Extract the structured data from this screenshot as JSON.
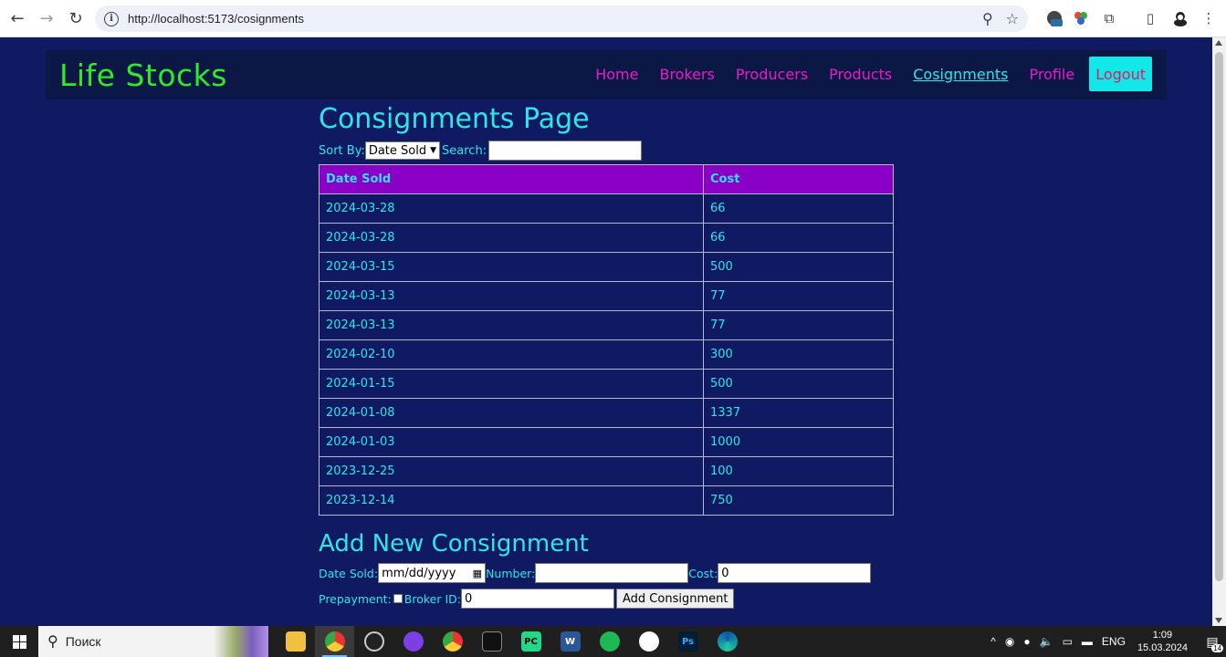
{
  "browser": {
    "url": "http://localhost:5173/cosignments"
  },
  "site": {
    "brand": "Life Stocks",
    "nav": [
      "Home",
      "Brokers",
      "Producers",
      "Products",
      "Cosignments",
      "Profile"
    ],
    "active_nav": "Cosignments",
    "logout_label": "Logout",
    "colors": {
      "background": "#0f1a63",
      "brand": "#2eea28",
      "nav_link": "#e61ec8",
      "accent": "#2ee6e6",
      "table_header": "#8a00c7"
    }
  },
  "page": {
    "title": "Consignments Page",
    "sort_label": "Sort By:",
    "sort_value": "Date Sold",
    "search_label": "Search:",
    "search_value": "",
    "table": {
      "headers": [
        "Date Sold",
        "Cost"
      ],
      "rows": [
        [
          "2024-03-28",
          "66"
        ],
        [
          "2024-03-28",
          "66"
        ],
        [
          "2024-03-15",
          "500"
        ],
        [
          "2024-03-13",
          "77"
        ],
        [
          "2024-03-13",
          "77"
        ],
        [
          "2024-02-10",
          "300"
        ],
        [
          "2024-01-15",
          "500"
        ],
        [
          "2024-01-08",
          "1337"
        ],
        [
          "2024-01-03",
          "1000"
        ],
        [
          "2023-12-25",
          "100"
        ],
        [
          "2023-12-14",
          "750"
        ]
      ]
    },
    "add_form": {
      "title": "Add New Consignment",
      "date_sold_label": "Date Sold:",
      "date_sold_placeholder": "mm/dd/yyyy",
      "number_label": "Number:",
      "number_value": "",
      "cost_label": "Cost:",
      "cost_value": "0",
      "prepayment_label": "Prepayment:",
      "broker_id_label": "Broker ID:",
      "broker_id_value": "0",
      "submit_label": "Add Consignment"
    }
  },
  "taskbar": {
    "search_placeholder": "Поиск",
    "language": "ENG",
    "time": "1:09",
    "date": "15.03.2024",
    "notifications": "14"
  }
}
